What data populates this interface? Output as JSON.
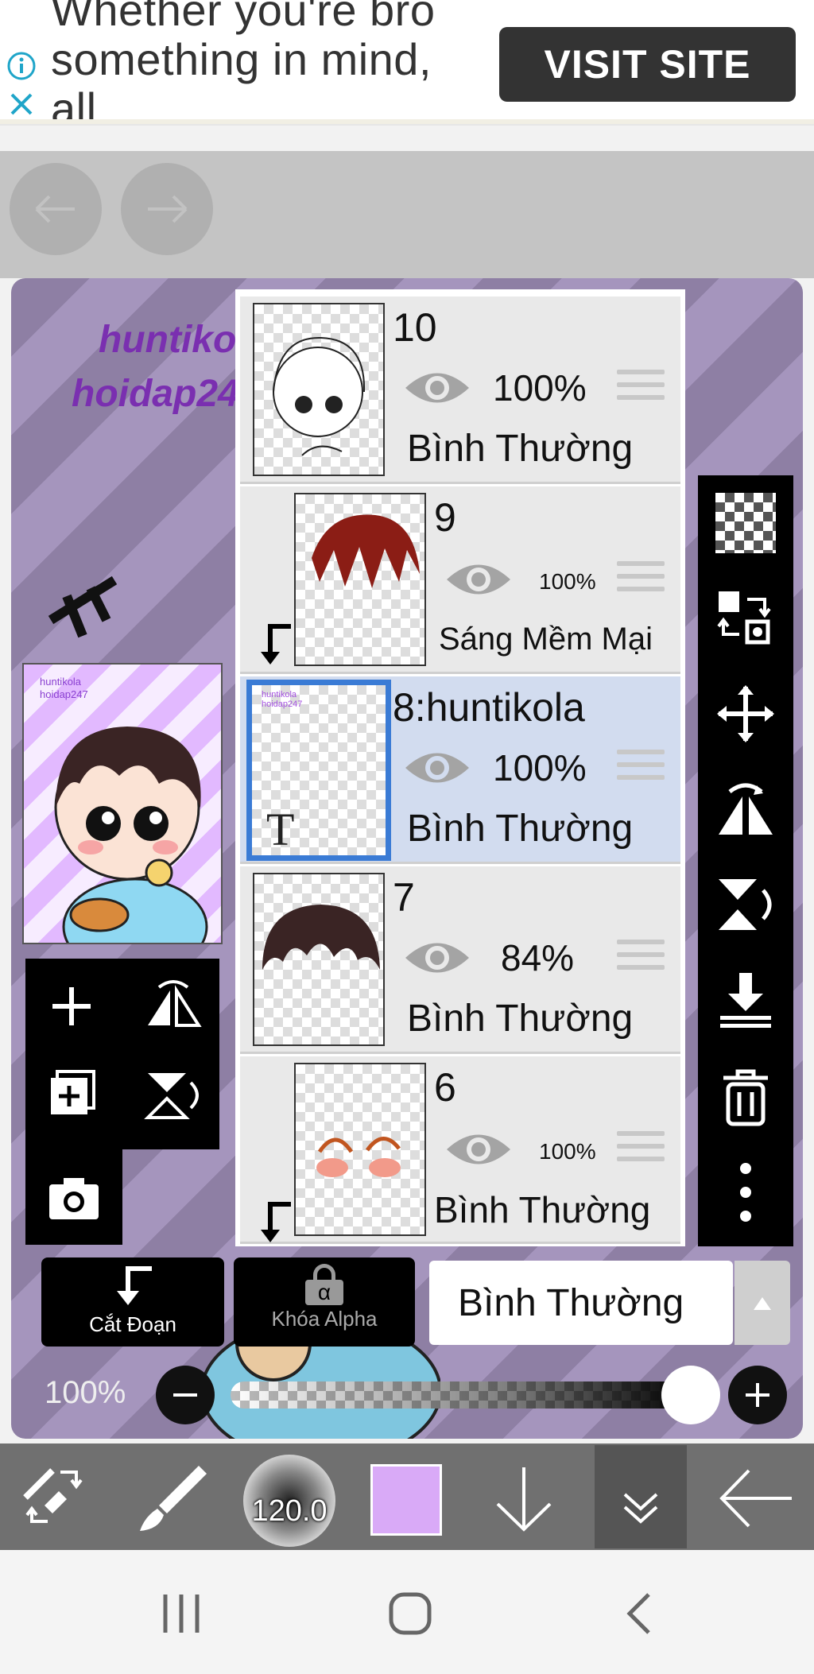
{
  "ad": {
    "text": "Whether you're bro\nsomething in mind,\nall.",
    "button_label": "VISIT SITE"
  },
  "canvas": {
    "watermark_line1": "huntiko",
    "watermark_line2": "hoidap24"
  },
  "layers": [
    {
      "name": "10",
      "opacity": "100%",
      "blend": "Bình Thường",
      "selected": false,
      "clipped": false
    },
    {
      "name": "9",
      "opacity": "100%",
      "blend": "Sáng Mềm Mại",
      "selected": false,
      "clipped": true
    },
    {
      "name": "8:huntikola",
      "opacity": "100%",
      "blend": "Bình Thường",
      "selected": true,
      "clipped": false,
      "thumb_letter": "T"
    },
    {
      "name": "7",
      "opacity": "84%",
      "blend": "Bình Thường",
      "selected": false,
      "clipped": false
    },
    {
      "name": "6",
      "opacity": "100%",
      "blend": "Bình Thường",
      "selected": false,
      "clipped": true
    }
  ],
  "controls": {
    "clip_label": "Cắt Đoạn",
    "alpha_lock_label": "Khóa Alpha",
    "alpha_symbol": "α",
    "blend_mode": "Bình Thường",
    "opacity_label": "100%",
    "opacity_value": 1.0
  },
  "bottombar": {
    "brush_size": "120.0",
    "color": "#d9aaf7"
  },
  "icons": {
    "right_toolbar": [
      "transparency-icon",
      "swap-layers-icon",
      "move-icon",
      "flip-horizontal-icon",
      "flip-vertical-icon",
      "merge-down-icon",
      "trash-icon",
      "more-icon"
    ],
    "left_toolbar": [
      "add-layer-icon",
      "flip-horizontal-icon",
      "add-copy-layer-icon",
      "flip-vertical-icon",
      "camera-icon"
    ]
  },
  "colors": {
    "accent_selected": "#3a7bd5",
    "brush_color": "#d9aaf7"
  }
}
